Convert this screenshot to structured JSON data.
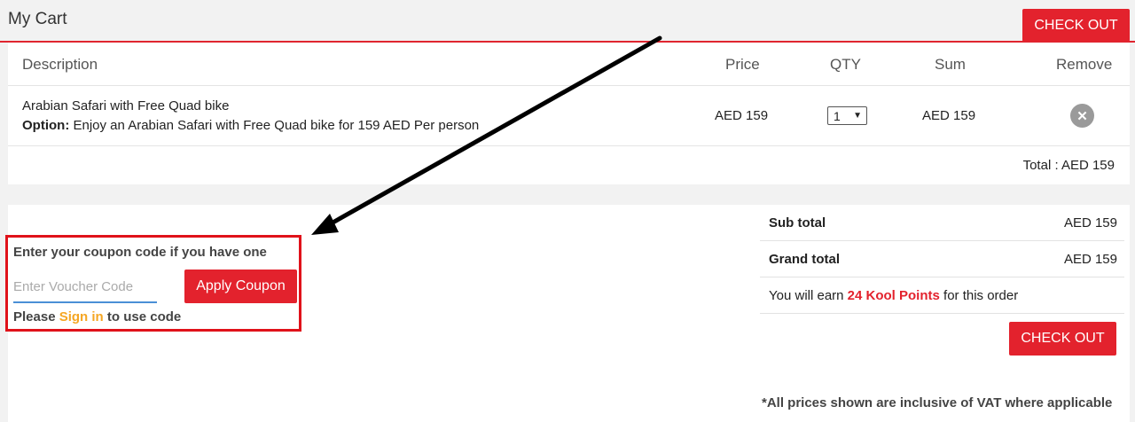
{
  "header": {
    "title": "My Cart",
    "checkout_label": "CHECK OUT"
  },
  "cart": {
    "columns": [
      "Description",
      "Price",
      "QTY",
      "Sum",
      "Remove"
    ],
    "item": {
      "name": "Arabian Safari with Free Quad bike",
      "option_label": "Option:",
      "option_text": " Enjoy an Arabian Safari with Free Quad bike for 159 AED Per person",
      "price": "AED 159",
      "qty": "1",
      "sum": "AED 159",
      "remove_icon": "close-circle-icon"
    },
    "total": "Total : AED 159"
  },
  "coupon": {
    "heading": "Enter your coupon code if you have one",
    "placeholder": "Enter Voucher Code",
    "value": "",
    "apply_label": "Apply Coupon",
    "signin_prefix": "Please ",
    "signin_link": "Sign in",
    "signin_suffix": " to use code"
  },
  "summary": {
    "subtotal_label": "Sub total",
    "subtotal_value": "AED 159",
    "grand_label": "Grand total",
    "grand_value": "AED 159",
    "earn_prefix": "You will earn ",
    "earn_points": "24 Kool Points",
    "earn_suffix": " for this order",
    "checkout_label": "CHECK OUT"
  },
  "vat_note": "*All prices shown are inclusive of VAT where applicable",
  "colors": {
    "accent_red": "#e3222d",
    "link_orange": "#f5a623",
    "input_underline": "#4a8fd6",
    "highlight_box": "#e0121a"
  }
}
